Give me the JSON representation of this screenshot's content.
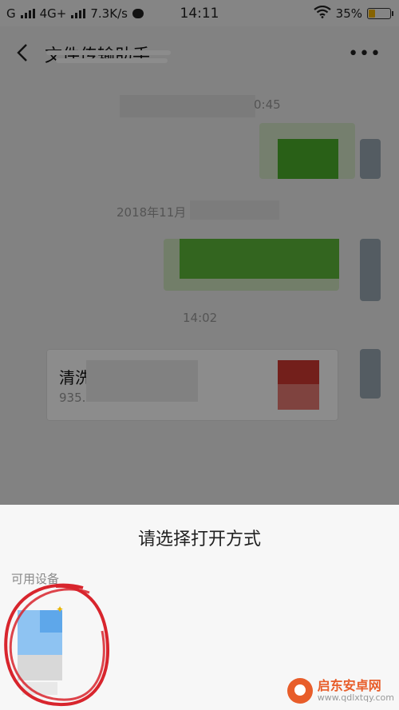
{
  "status_bar": {
    "carrier": "G",
    "network": "4G+",
    "speed": "7.3K/s",
    "time": "14:11",
    "battery_percent": "35%",
    "battery_level": 0.35
  },
  "header": {
    "title": "文件传输助手"
  },
  "chat": {
    "timestamp_1": "0:45",
    "timestamp_2": "2018年11月",
    "timestamp_3": "14:02",
    "file_card": {
      "name": "清洗",
      "size": "935."
    }
  },
  "sheet": {
    "title": "请选择打开方式",
    "section_label": "可用设备"
  },
  "watermark": {
    "name": "启东安卓网",
    "url": "www.qdlxtqy.com"
  },
  "colors": {
    "chat_bg": "#ededed",
    "bubble_green": "#95ec69",
    "overlay": "rgba(0,0,0,0.45)",
    "sheet_bg": "#f7f7f7",
    "annotation_red": "#d8252d"
  }
}
